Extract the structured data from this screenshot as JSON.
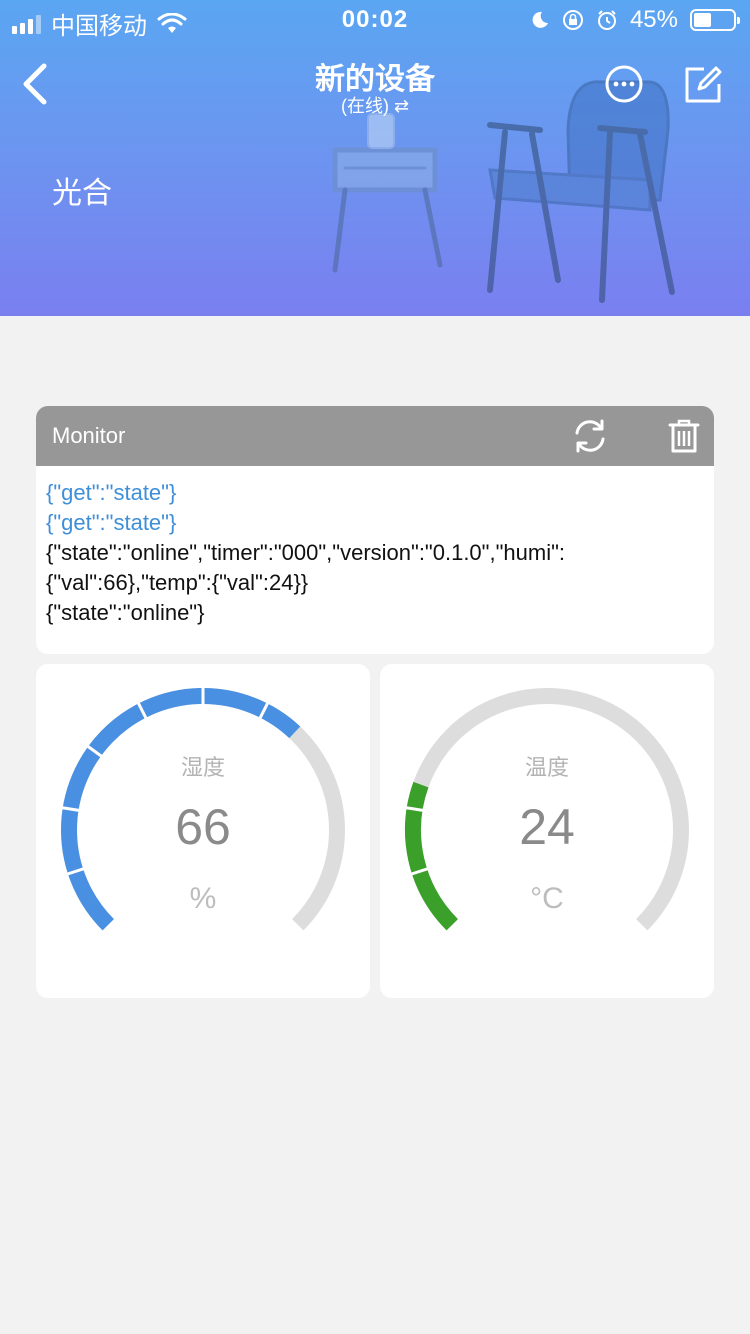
{
  "status_bar": {
    "carrier": "中国移动",
    "time": "00:02",
    "battery_percent": "45%",
    "battery_level": 0.45,
    "icons": [
      "signal-icon",
      "wifi-icon",
      "moon-icon",
      "orientation-lock-icon",
      "alarm-icon",
      "battery-icon"
    ]
  },
  "nav": {
    "title": "新的设备",
    "subtitle": "(在线) ⇄",
    "back_icon": "chevron-left-icon",
    "more_icon": "ellipsis-circle-icon",
    "edit_icon": "edit-icon"
  },
  "group_label": "光合",
  "monitor": {
    "title": "Monitor",
    "refresh_icon": "refresh-icon",
    "delete_icon": "trash-icon",
    "lines": [
      {
        "text": "{\"get\":\"state\"}",
        "type": "sent"
      },
      {
        "text": "{\"get\":\"state\"}",
        "type": "sent"
      },
      {
        "text": "{\"state\":\"online\",\"timer\":\"000\",\"version\":\"0.1.0\",\"humi\":",
        "type": "received"
      },
      {
        "text": "{\"val\":66},\"temp\":{\"val\":24}}",
        "type": "received"
      },
      {
        "text": "{\"state\":\"online\"}",
        "type": "received"
      }
    ]
  },
  "gauges": [
    {
      "label": "湿度",
      "value": "66",
      "unit": "%",
      "fraction": 0.66,
      "color": "#4a90e2",
      "track_color": "#dddddd"
    },
    {
      "label": "温度",
      "value": "24",
      "unit": "°C",
      "fraction": 0.24,
      "color": "#3aa02a",
      "track_color": "#dddddd"
    }
  ],
  "colors": {
    "header_top": "#5aa6f2",
    "monitor_header": "#979797",
    "sent_text": "#3f8fd8"
  }
}
